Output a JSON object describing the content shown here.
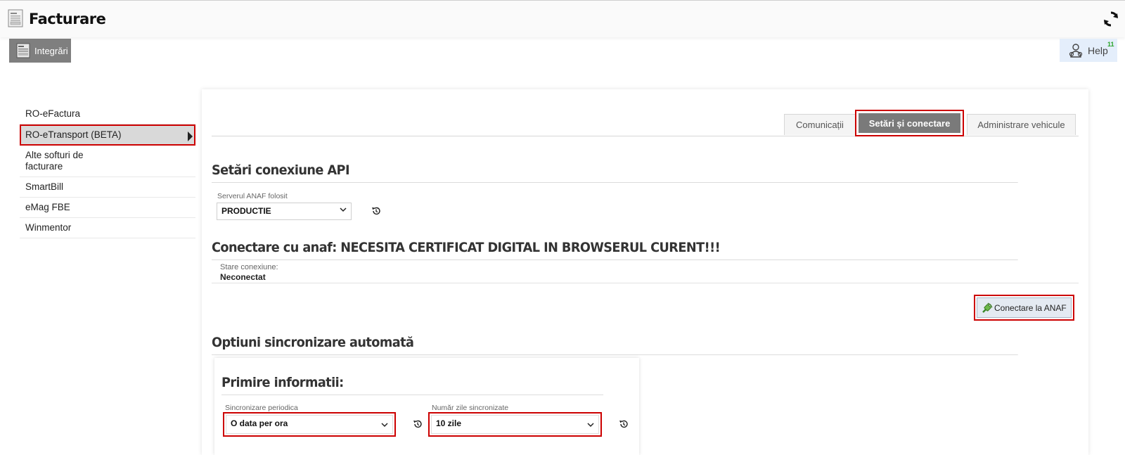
{
  "app": {
    "title": "Facturare"
  },
  "nav": {
    "integrari_label": "Integrări"
  },
  "help": {
    "label": "Help",
    "badge": "11"
  },
  "sidebar": {
    "items": [
      {
        "label": "RO-eFactura"
      },
      {
        "label": "RO-eTransport (BETA)"
      },
      {
        "label": "Alte softuri de facturare"
      },
      {
        "label": "SmartBill"
      },
      {
        "label": "eMag FBE"
      },
      {
        "label": "Winmentor"
      }
    ]
  },
  "tabs": [
    {
      "label": "Comunicații"
    },
    {
      "label": "Setări și conectare"
    },
    {
      "label": "Administrare vehicule"
    }
  ],
  "api_section": {
    "title": "Setări conexiune API",
    "server_label": "Serverul ANAF folosit",
    "server_value": "PRODUCTIE"
  },
  "connect_section": {
    "title": "Conectare cu anaf: NECESITA CERTIFICAT DIGITAL IN BROWSERUL CURENT!!!",
    "status_label": "Stare conexiune:",
    "status_value": "Neconectat",
    "button_label": "Conectare la ANAF"
  },
  "sync_section": {
    "title": "Optiuni sincronizare automată",
    "card_title": "Primire informatii:",
    "periodic_label": "Sincronizare periodica",
    "periodic_value": "O data per ora",
    "days_label": "Număr zile sincronizate",
    "days_value": "10 zile"
  },
  "colors": {
    "highlight": "#cc0000",
    "active_tab": "#7a7a7a",
    "help_bg": "#e4eefb"
  }
}
